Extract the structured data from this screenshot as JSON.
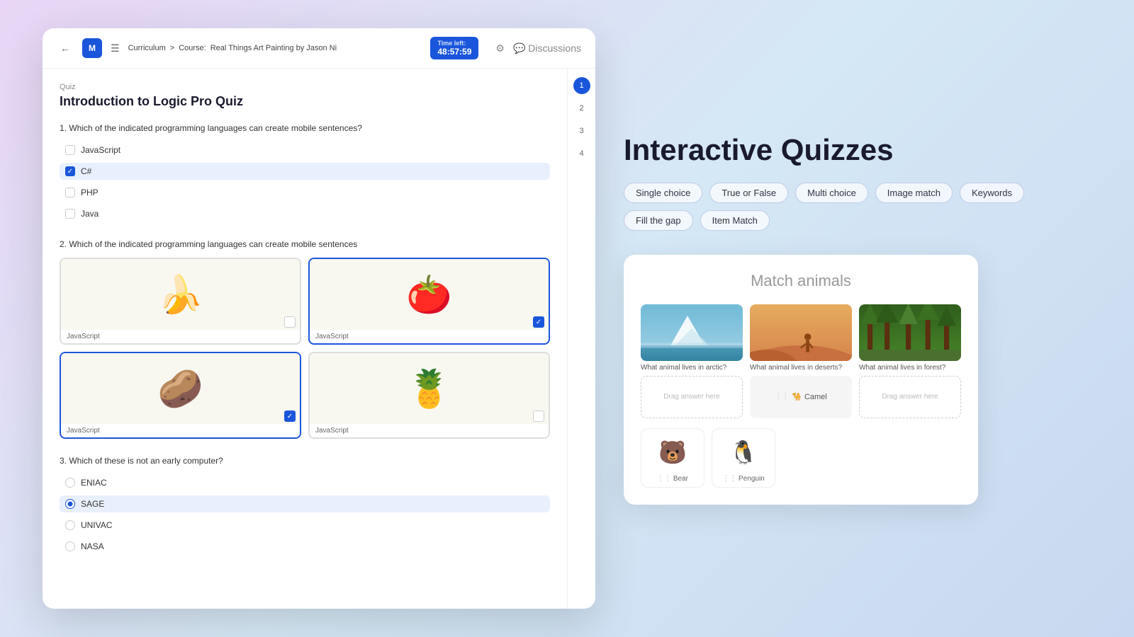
{
  "page": {
    "background": "linear-gradient(135deg, #e8d5f5, #d5e8f5, #c8d8f0)"
  },
  "heading": {
    "title": "Interactive Quizzes"
  },
  "tags": [
    {
      "label": "Single choice",
      "id": "single-choice"
    },
    {
      "label": "True or False",
      "id": "true-false"
    },
    {
      "label": "Multi choice",
      "id": "multi-choice"
    },
    {
      "label": "Image match",
      "id": "image-match"
    },
    {
      "label": "Keywords",
      "id": "keywords"
    },
    {
      "label": "Fill the gap",
      "id": "fill-gap"
    },
    {
      "label": "Item Match",
      "id": "item-match"
    }
  ],
  "quiz": {
    "breadcrumb_curriculum": "Curriculum",
    "breadcrumb_course_label": "Course:",
    "breadcrumb_course": "Real Things Art Painting by Jason Ni",
    "timer_label": "Time left:",
    "timer_value": "48:57:59",
    "discussions": "Discussions",
    "label": "Quiz",
    "title": "Introduction to Logic Pro Quiz",
    "questions": [
      {
        "number": "1.",
        "text": "Which of the indicated programming languages can create mobile sentences?",
        "type": "checkbox",
        "options": [
          {
            "label": "JavaScript",
            "checked": false,
            "selected": false
          },
          {
            "label": "C#",
            "checked": true,
            "selected": true
          },
          {
            "label": "PHP",
            "checked": false,
            "selected": false
          },
          {
            "label": "Java",
            "checked": false,
            "selected": false
          }
        ]
      },
      {
        "number": "2.",
        "text": "Which of the indicated programming languages can create mobile sentences",
        "type": "image",
        "options": [
          {
            "label": "JavaScript",
            "emoji": "🍌",
            "selected": false
          },
          {
            "label": "JavaScript",
            "emoji": "🍅",
            "selected": true
          },
          {
            "label": "JavaScript",
            "emoji": "🥔",
            "selected": true
          },
          {
            "label": "JavaScript",
            "emoji": "🍍",
            "selected": false
          }
        ]
      },
      {
        "number": "3.",
        "text": "Which of these is not an early computer?",
        "type": "radio",
        "options": [
          {
            "label": "ENIAC",
            "checked": false,
            "selected": false
          },
          {
            "label": "SAGE",
            "checked": true,
            "selected": true
          },
          {
            "label": "UNIVAC",
            "checked": false,
            "selected": false
          },
          {
            "label": "NASA",
            "checked": false,
            "selected": false
          }
        ]
      }
    ],
    "sidebar_numbers": [
      "1",
      "2",
      "3",
      "4"
    ]
  },
  "match_quiz": {
    "title": "Match animals",
    "columns": [
      {
        "question": "What animal lives in arctic?",
        "bg_type": "arctic",
        "drop_text": "Drag answer here",
        "has_answer": false
      },
      {
        "question": "What animal lives in deserts?",
        "bg_type": "desert",
        "drop_text": "Drag answer here",
        "has_answer": true,
        "answer_label": "Camel",
        "answer_emoji": "🐪"
      },
      {
        "question": "What animal lives in forest?",
        "bg_type": "forest",
        "drop_text": "Drag answer here",
        "has_answer": false
      }
    ],
    "answer_items": [
      {
        "label": "Bear",
        "emoji": "🐻"
      },
      {
        "label": "Penguin",
        "emoji": "🐧"
      }
    ]
  }
}
